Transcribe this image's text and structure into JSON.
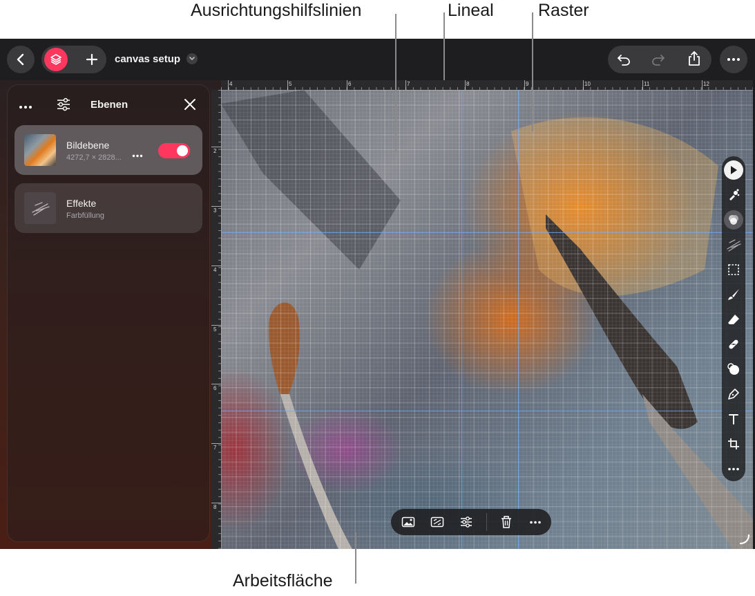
{
  "callouts": {
    "guides": "Ausrichtungshilfslinien",
    "ruler": "Lineal",
    "grid": "Raster",
    "canvas": "Arbeitsfläche"
  },
  "toolbar": {
    "document_title": "canvas setup"
  },
  "layers_panel": {
    "title": "Ebenen",
    "layers": [
      {
        "name": "Bildebene",
        "subtitle": "4272,7 × 2828...",
        "visible": true
      },
      {
        "name": "Effekte",
        "subtitle": "Farbfüllung"
      }
    ]
  },
  "ruler": {
    "top_numbers": [
      "4",
      "5",
      "6",
      "7",
      "8",
      "9",
      "10",
      "11",
      "12"
    ],
    "left_numbers": [
      "2",
      "3",
      "4",
      "5",
      "6",
      "7",
      "8"
    ]
  },
  "colors": {
    "accent": "#ff375f",
    "toolbar": "#1e1e20",
    "guide": "#6eaaff"
  },
  "icons": {
    "back": "chevron-left-icon",
    "layers": "layers-icon",
    "add": "plus-icon",
    "undo": "undo-icon",
    "redo": "redo-icon",
    "share": "share-icon",
    "more": "ellipsis-icon"
  }
}
